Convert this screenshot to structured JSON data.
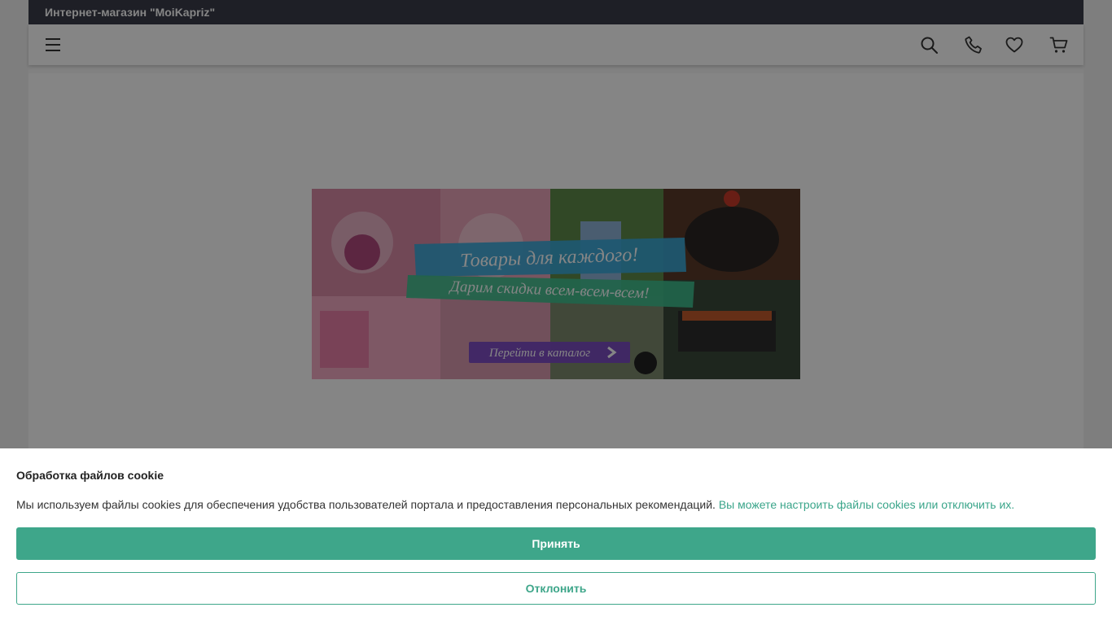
{
  "topbar": {
    "title": "Интернет-магазин \"MoiKapriz\""
  },
  "navbar": {
    "icons": [
      "menu-icon",
      "search-icon",
      "phone-icon",
      "heart-icon",
      "cart-icon"
    ]
  },
  "banner": {
    "headline": "Товары для каждого!",
    "subheadline": "Дарим скидки всем-всем-всем!",
    "cta": "Перейти в каталог"
  },
  "cookie": {
    "title": "Обработка файлов cookie",
    "text": "Мы используем файлы cookies для обеспечения удобства пользователей портала и предоставления персональных рекомендаций.",
    "link": "Вы можете настроить файлы cookies или отключить их.",
    "accept": "Принять",
    "decline": "Отклонить"
  },
  "colors": {
    "topbar": "#3a3d4a",
    "accent": "#3ea68a",
    "banner_blue_ribbon": "#3aa9d8",
    "banner_green_ribbon": "#3fbf8f",
    "banner_purple_button": "#7b4bc4"
  }
}
